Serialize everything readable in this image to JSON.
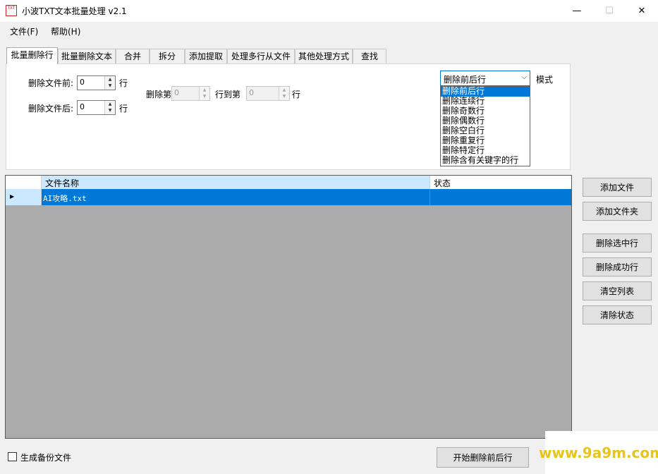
{
  "window": {
    "title": "小波TXT文本批量处理 v2.1",
    "icon_text": "TXT",
    "minimize_glyph": "—",
    "maximize_glyph": "☐",
    "close_glyph": "✕"
  },
  "menu": {
    "items": [
      {
        "label": "文件(F)"
      },
      {
        "label": "帮助(H)"
      }
    ]
  },
  "tabs": [
    {
      "label": "批量删除行",
      "active": true
    },
    {
      "label": "批量删除文本"
    },
    {
      "label": "合并"
    },
    {
      "label": "拆分"
    },
    {
      "label": "添加提取"
    },
    {
      "label": "处理多行从文件"
    },
    {
      "label": "其他处理方式"
    },
    {
      "label": "查找"
    }
  ],
  "panel": {
    "delete_before_label": "删除文件前:",
    "delete_before_value": "0",
    "delete_after_label": "删除文件后:",
    "delete_after_value": "0",
    "line_unit": "行",
    "delete_from_label": "删除第",
    "delete_from_value": "0",
    "to_line_label": "行到第",
    "to_line_value": "0",
    "mode_label": "模式",
    "mode_selected": "删除前后行",
    "mode_options": [
      "删除前后行",
      "删除连续行",
      "删除奇数行",
      "删除偶数行",
      "删除空白行",
      "删除重复行",
      "删除特定行",
      "删除含有关键字的行"
    ]
  },
  "grid": {
    "columns": [
      "文件名称",
      "状态"
    ],
    "rows": [
      {
        "name": "AI攻略.txt",
        "status": ""
      }
    ]
  },
  "side_buttons": {
    "add_file": "添加文件",
    "add_folder": "添加文件夹",
    "delete_selected": "删除选中行",
    "delete_success": "删除成功行",
    "clear_list": "清空列表",
    "clear_status": "清除状态"
  },
  "bottom": {
    "backup_label": "生成备份文件",
    "backup_checked": false,
    "start_button": "开始删除前后行"
  },
  "watermark": "www.9a9m.com",
  "colors": {
    "selection": "#0078d7",
    "header_highlight": "#cce8ff",
    "grid_background": "#ababab",
    "watermark": "#e8c51c"
  }
}
